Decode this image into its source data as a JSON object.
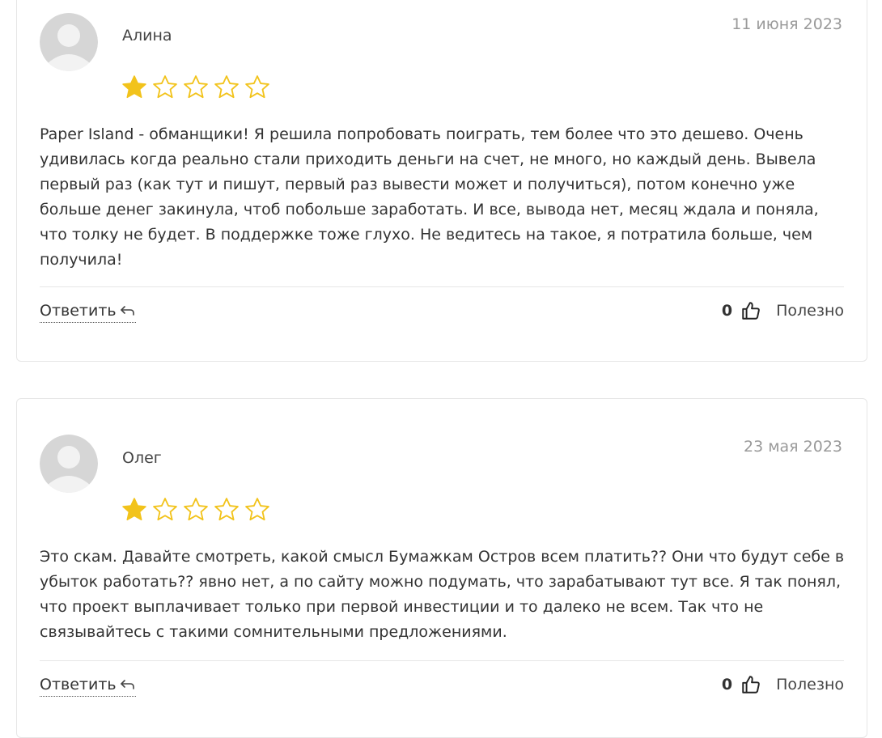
{
  "reviews": [
    {
      "author": "Алина",
      "date": "11 июня 2023",
      "rating": 1,
      "max_rating": 5,
      "text": "Paper Island - обманщики! Я решила попробовать поиграть, тем более что это дешево. Очень удивилась когда реально стали приходить деньги на счет, не много, но каждый день. Вывела первый раз (как тут и пишут, первый раз вывести может и получиться), потом конечно уже больше денег закинула, чтоб побольше заработать. И все, вывода нет, месяц ждала и поняла, что толку не будет. В поддержке тоже глухо. Не ведитесь на такое, я потратила больше, чем получила!",
      "reply_label": "Ответить",
      "likes": "0",
      "helpful_label": "Полезно"
    },
    {
      "author": "Олег",
      "date": "23 мая 2023",
      "rating": 1,
      "max_rating": 5,
      "text": "Это скам. Давайте смотреть, какой смысл Бумажкам Остров всем платить?? Они что будут себе в убыток работать?? явно нет, а по сайту можно подумать, что зарабатывают тут все. Я так понял, что проект выплачивает только при первой инвестиции и то далеко не всем. Так что не связывайтесь с такими сомнительными предложениями.",
      "reply_label": "Ответить",
      "likes": "0",
      "helpful_label": "Полезно"
    }
  ],
  "colors": {
    "star_filled": "#F2C31B",
    "star_empty_stroke": "#F2C31B",
    "avatar_bg": "#D6D6D6",
    "avatar_fg": "#F2F2F2",
    "date": "#9A9A9A",
    "border": "#E6E6E6"
  },
  "icons": {
    "avatar": "default-user-avatar",
    "star": "star-icon",
    "reply": "reply-arrow-icon",
    "thumb": "thumbs-up-icon"
  }
}
